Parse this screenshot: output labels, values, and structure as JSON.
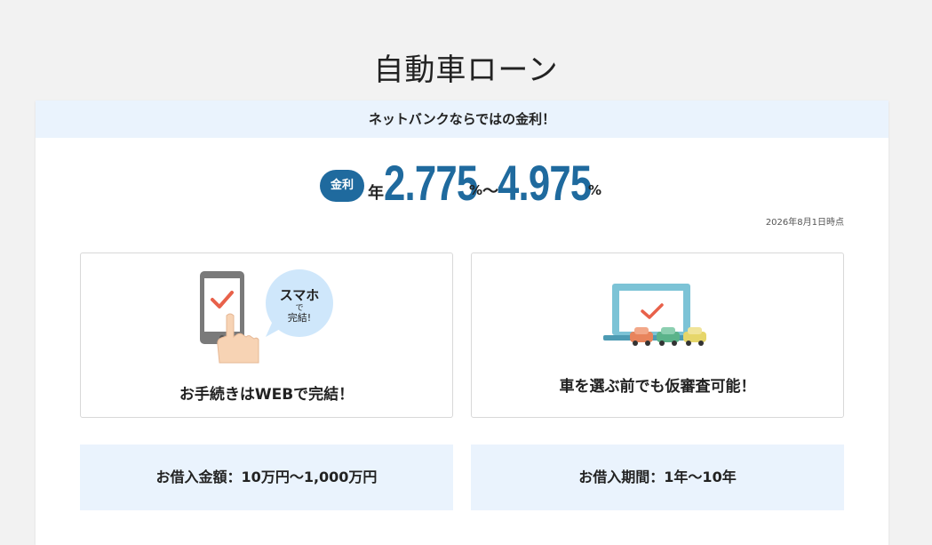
{
  "page": {
    "title": "自動車ローン"
  },
  "banner": {
    "text": "ネットバンクならではの金利！"
  },
  "rate": {
    "badge": "金利",
    "prefix": "年",
    "min": "2.775",
    "max": "4.975",
    "unit": "%",
    "separator": "～",
    "as_of": "2026年8月1日時点"
  },
  "features": {
    "web": {
      "label": "お手続きはWEBで完結！",
      "bubble_line1": "スマホ",
      "bubble_line2": "で",
      "bubble_line3": "完結!",
      "icon": "smartphone-check-icon"
    },
    "prescreen": {
      "label": "車を選ぶ前でも仮審査可能！",
      "icon": "laptop-cars-icon"
    }
  },
  "info": {
    "amount": "お借入金額：10万円～1,000万円",
    "term": "お借入期間：1年～10年"
  },
  "colors": {
    "accent": "#1f6a9e",
    "banner_bg": "#eaf3fd",
    "check": "#e8614a"
  }
}
